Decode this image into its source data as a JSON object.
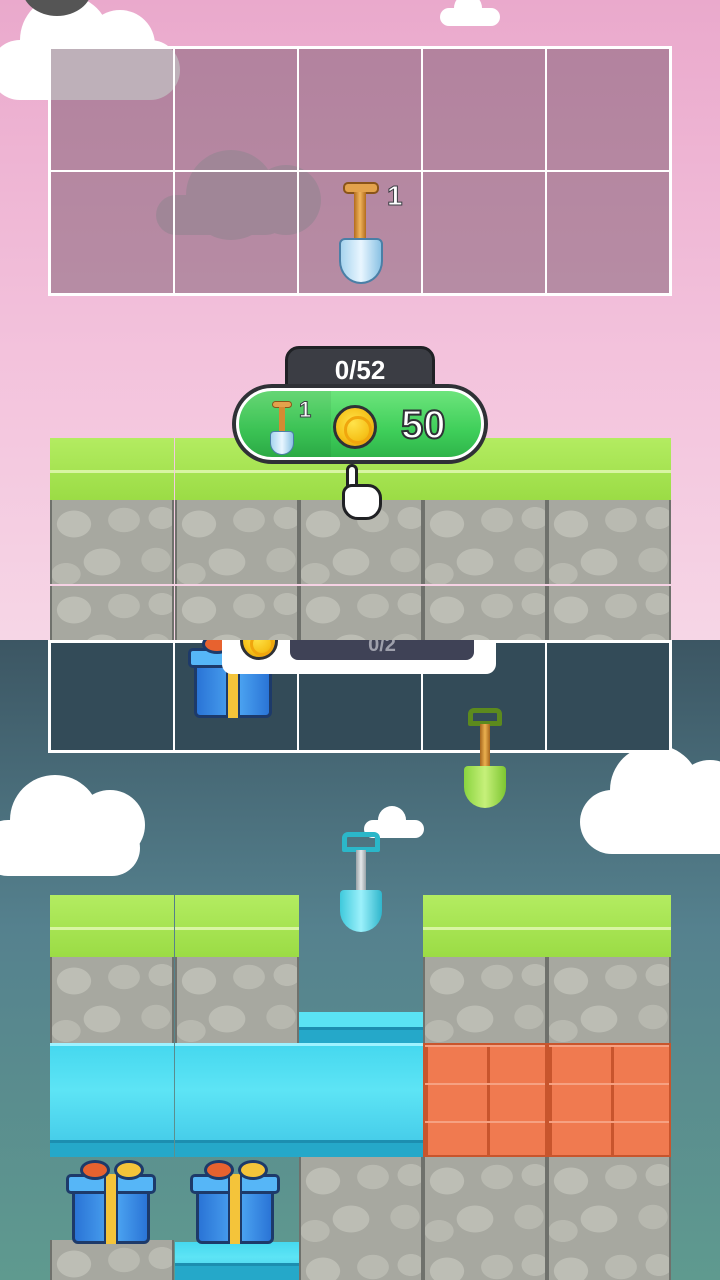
{
  "top_panel": {
    "inventory": {
      "shovel_count_label": "1"
    },
    "progress_counter": "0/52",
    "reward_button": {
      "shovel_count_label": "1",
      "coin_amount": "50"
    }
  },
  "bottom_panel": {
    "popup_counter_fragment": "0/2"
  },
  "colors": {
    "grass": "#9bdc45",
    "stone": "#a7a8a0",
    "water": "#46d8ef",
    "brick": "#f07a50",
    "reward_green": "#3fcf5a",
    "coin_gold": "#f6c21a",
    "top_sky": "#f3c2dc",
    "bottom_sky": "#55818e"
  },
  "icons": [
    "gold-shovel-icon",
    "coin-icon",
    "pointer-hand-icon",
    "gift-box-icon",
    "green-shovel-icon",
    "cyan-shovel-icon"
  ]
}
